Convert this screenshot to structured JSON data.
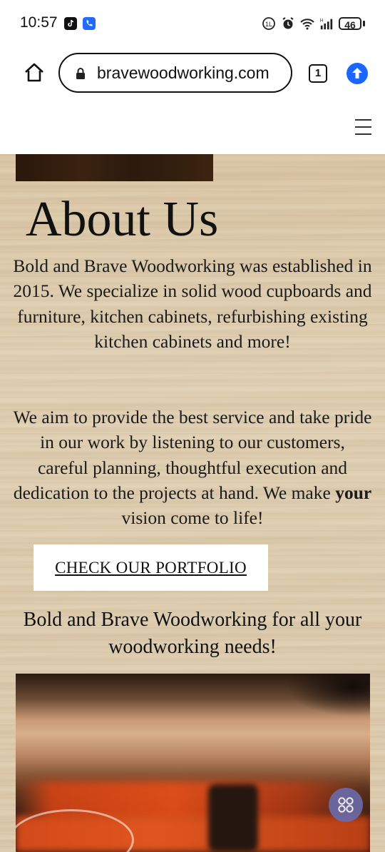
{
  "status_bar": {
    "time": "10:57",
    "battery": "46"
  },
  "browser": {
    "url": "bravewoodworking.com",
    "tab_count": "1"
  },
  "about": {
    "title": "About Us",
    "paragraph1": "Bold and Brave Woodworking was established in 2015. We specialize in solid wood cupboards and furniture, kitchen cabinets, refurbishing existing kitchen cabinets and more!",
    "paragraph2_before": "We aim to provide the best service and take pride in our work by listening to our customers, careful planning, thoughtful execution and dedication to the projects at hand. We make ",
    "paragraph2_bold": "your",
    "paragraph2_after": " vision come to life!",
    "portfolio_button": "CHECK OUR PORTFOLIO",
    "tagline": "Bold and Brave Woodworking for all your woodworking needs!"
  },
  "colors": {
    "accent_blue": "#1a66ff",
    "fab": "#6a6aa8"
  }
}
